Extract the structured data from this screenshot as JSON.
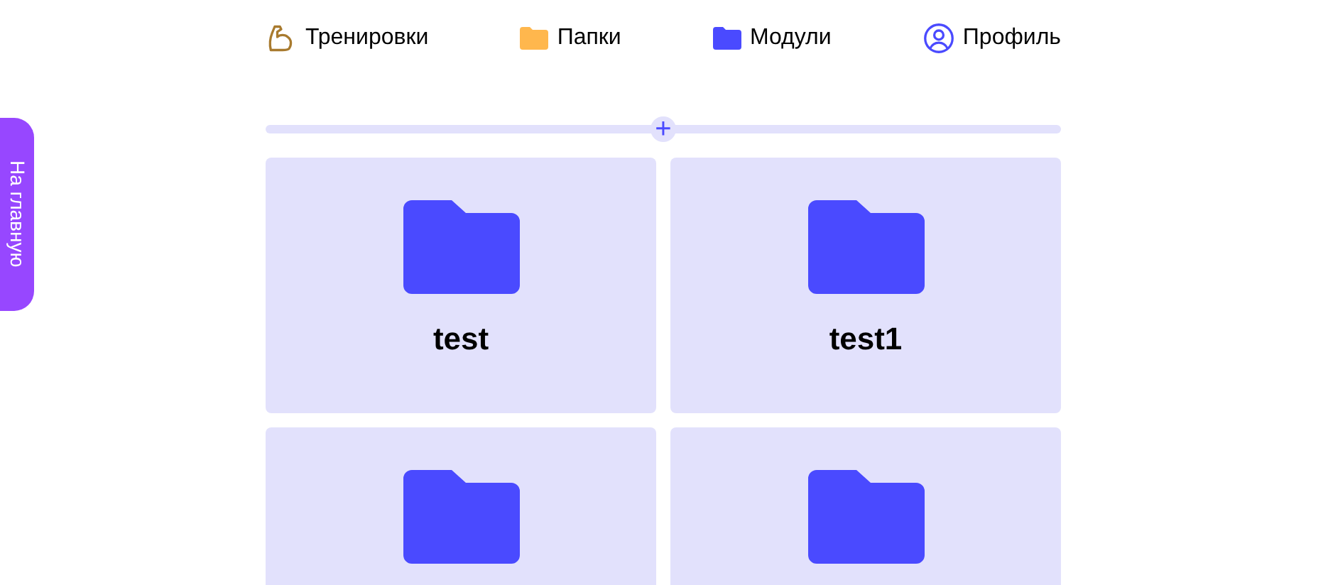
{
  "nav": [
    {
      "kind": "muscle",
      "label": "Тренировки"
    },
    {
      "kind": "folder",
      "label": "Папки"
    },
    {
      "kind": "modules",
      "label": "Модули"
    },
    {
      "kind": "profile",
      "label": "Профиль"
    }
  ],
  "side_tab": {
    "label": "На главную"
  },
  "add_bar": {
    "label": "+"
  },
  "folders": [
    {
      "kind": "folder",
      "name": "test"
    },
    {
      "kind": "folder",
      "name": "test1"
    },
    {
      "kind": "folder"
    },
    {
      "kind": "folder"
    }
  ]
}
